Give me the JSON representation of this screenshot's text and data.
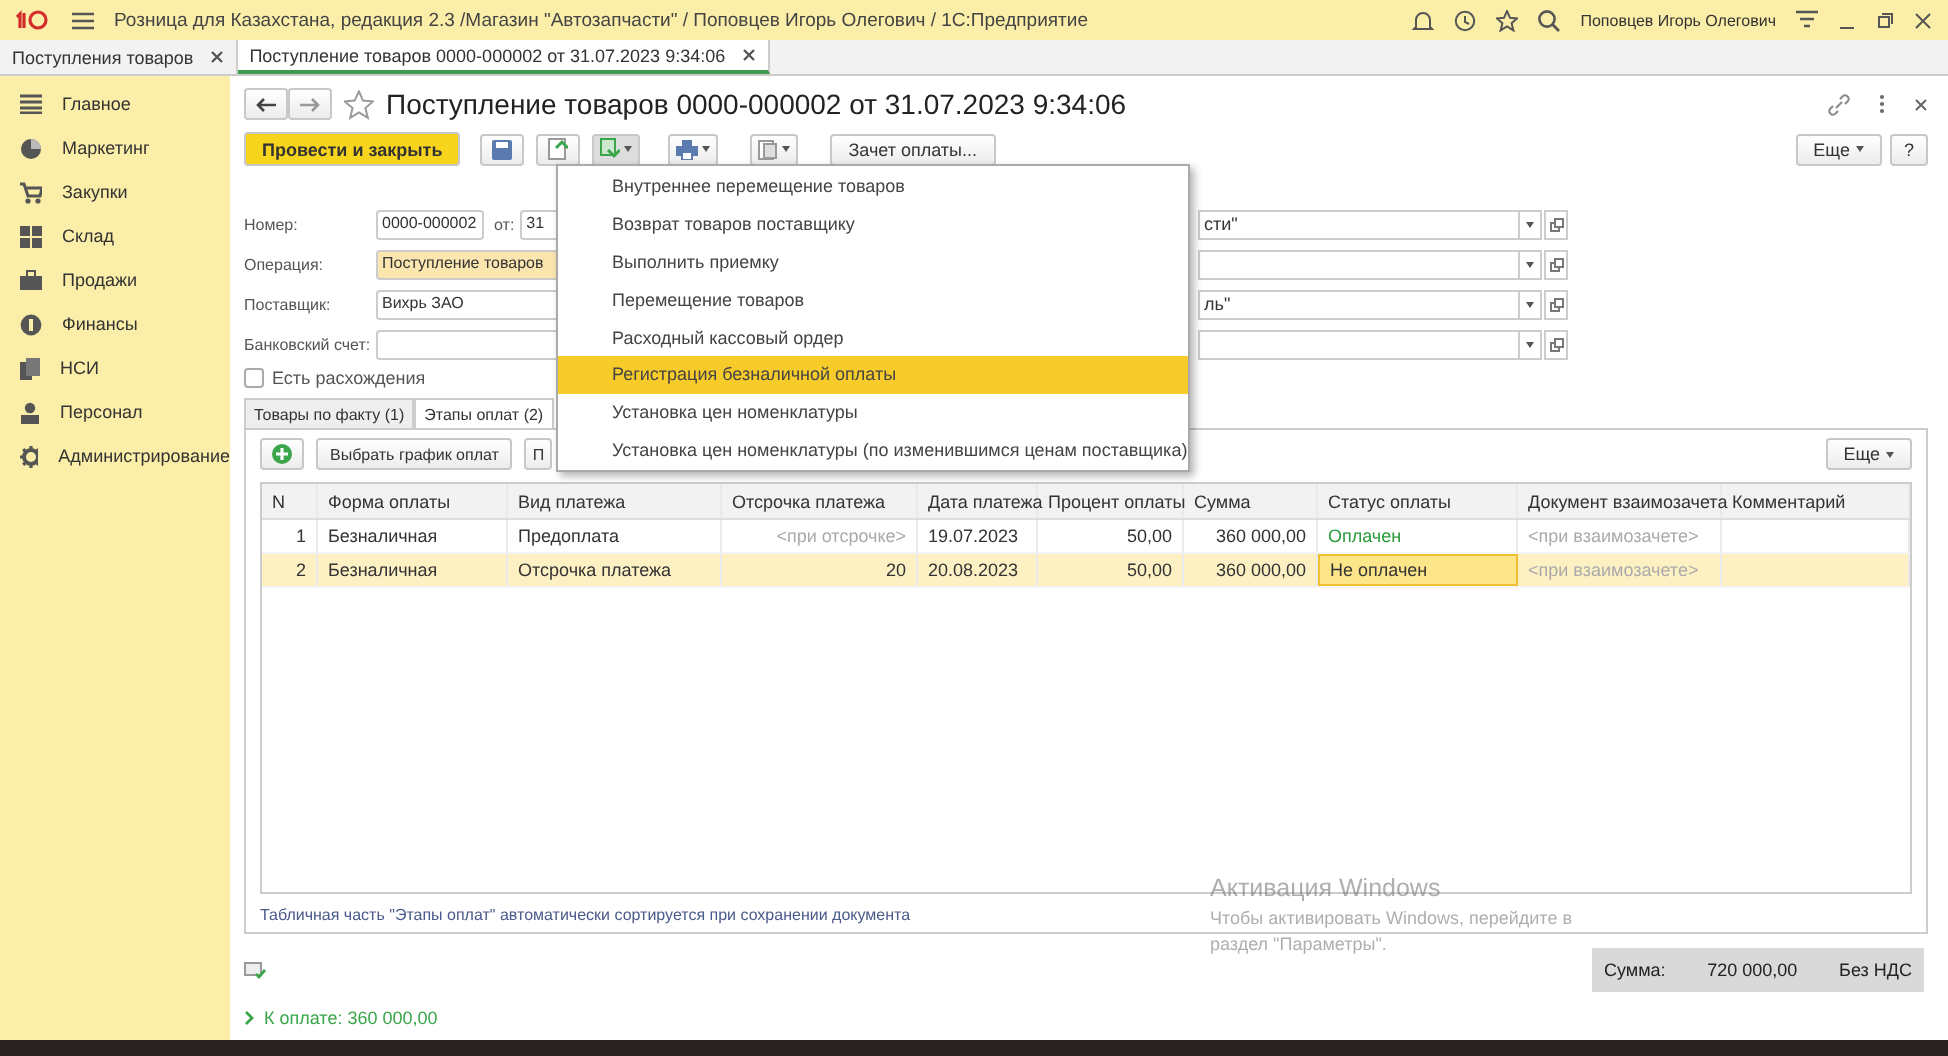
{
  "app": {
    "title": "Розница для Казахстана, редакция 2.3 /Магазин \"Автозапчасти\" / Поповцев Игорь Олегович / 1С:Предприятие",
    "user": "Поповцев Игорь Олегович"
  },
  "open_tabs": [
    {
      "label": "Поступления товаров",
      "selected": false
    },
    {
      "label": "Поступление товаров 0000-000002 от 31.07.2023 9:34:06",
      "selected": true
    }
  ],
  "sidebar": {
    "items": [
      {
        "label": "Главное"
      },
      {
        "label": "Маркетинг"
      },
      {
        "label": "Закупки"
      },
      {
        "label": "Склад"
      },
      {
        "label": "Продажи"
      },
      {
        "label": "Финансы"
      },
      {
        "label": "НСИ"
      },
      {
        "label": "Персонал"
      },
      {
        "label": "Администрирование"
      }
    ]
  },
  "form": {
    "title": "Поступление товаров 0000-000002 от 31.07.2023 9:34:06",
    "favorite": false,
    "post_button": "Провести и закрыть",
    "offset_button": "Зачет оплаты...",
    "more_button": "Еще",
    "help_button": "?",
    "menu": [
      {
        "label": "Внутреннее перемещение товаров",
        "selected": false
      },
      {
        "label": "Возврат товаров поставщику",
        "selected": false
      },
      {
        "label": "Выполнить приемку",
        "selected": false
      },
      {
        "label": "Перемещение товаров",
        "selected": false
      },
      {
        "label": "Расходный кассовый ордер",
        "selected": false
      },
      {
        "label": "Регистрация безналичной оплаты",
        "selected": true
      },
      {
        "label": "Установка цен номенклатуры",
        "selected": false
      },
      {
        "label": "Установка цен номенклатуры (по изменившимся ценам поставщика)",
        "selected": false
      }
    ],
    "fields": [
      {
        "label": "Номер:",
        "value": "0000-000002",
        "date_label": "от:",
        "date_value": "31",
        "right_value": "сти\""
      },
      {
        "label": "Операция:",
        "value": "Поступление товаров",
        "highlighted": true
      },
      {
        "label": "Поставщик:",
        "value": "Вихрь ЗАО",
        "right_value": "ль\""
      },
      {
        "label": "Банковский счет:"
      }
    ],
    "discrepancy": {
      "label": "Есть расхождения",
      "checked": false
    },
    "tabs": [
      {
        "label": "Товары по факту (1)",
        "selected": false
      },
      {
        "label": "Этапы оплат (2)",
        "selected": true
      }
    ],
    "table_toolbar": {
      "schedule_button": "Выбрать график оплат",
      "fill_button": "П",
      "more_button": "Еще"
    },
    "columns": [
      "N",
      "Форма оплаты",
      "Вид платежа",
      "Отсрочка платежа",
      "Дата платежа",
      "Процент оплаты",
      "Сумма",
      "Статус оплаты",
      "Документ взаимозачета",
      "Комментарий"
    ],
    "rows": [
      {
        "selected": false,
        "paid": true,
        "cells": [
          {
            "text": "1"
          },
          {
            "text": "Безналичная"
          },
          {
            "text": "Предоплата"
          },
          {
            "text": "<при отсрочке>",
            "hint": true
          },
          {
            "text": "19.07.2023"
          },
          {
            "text": "50,00"
          },
          {
            "text": "360 000,00"
          },
          {
            "text": "Оплачен"
          },
          {
            "text": "<при взаимозачете>",
            "hint": true
          },
          {
            "text": ""
          }
        ]
      },
      {
        "selected": true,
        "paid": false,
        "cells": [
          {
            "text": "2"
          },
          {
            "text": "Безналичная"
          },
          {
            "text": "Отсрочка платежа"
          },
          {
            "text": "20"
          },
          {
            "text": "20.08.2023"
          },
          {
            "text": "50,00"
          },
          {
            "text": "360 000,00"
          },
          {
            "text": "Не оплачен",
            "current": true
          },
          {
            "text": "<при взаимозачете>",
            "hint": true
          },
          {
            "text": ""
          }
        ]
      }
    ],
    "note": "Табличная часть \"Этапы оплат\" автоматически сортируется при сохранении документа",
    "to_pay": "К оплате: 360 000,00",
    "total": {
      "label": "Сумма:",
      "value": "720 000,00",
      "vat": "Без НДС"
    }
  },
  "os_notice": {
    "title": "Активация Windows",
    "text": "Чтобы активировать Windows, перейдите в раздел \"Параметры\"."
  }
}
